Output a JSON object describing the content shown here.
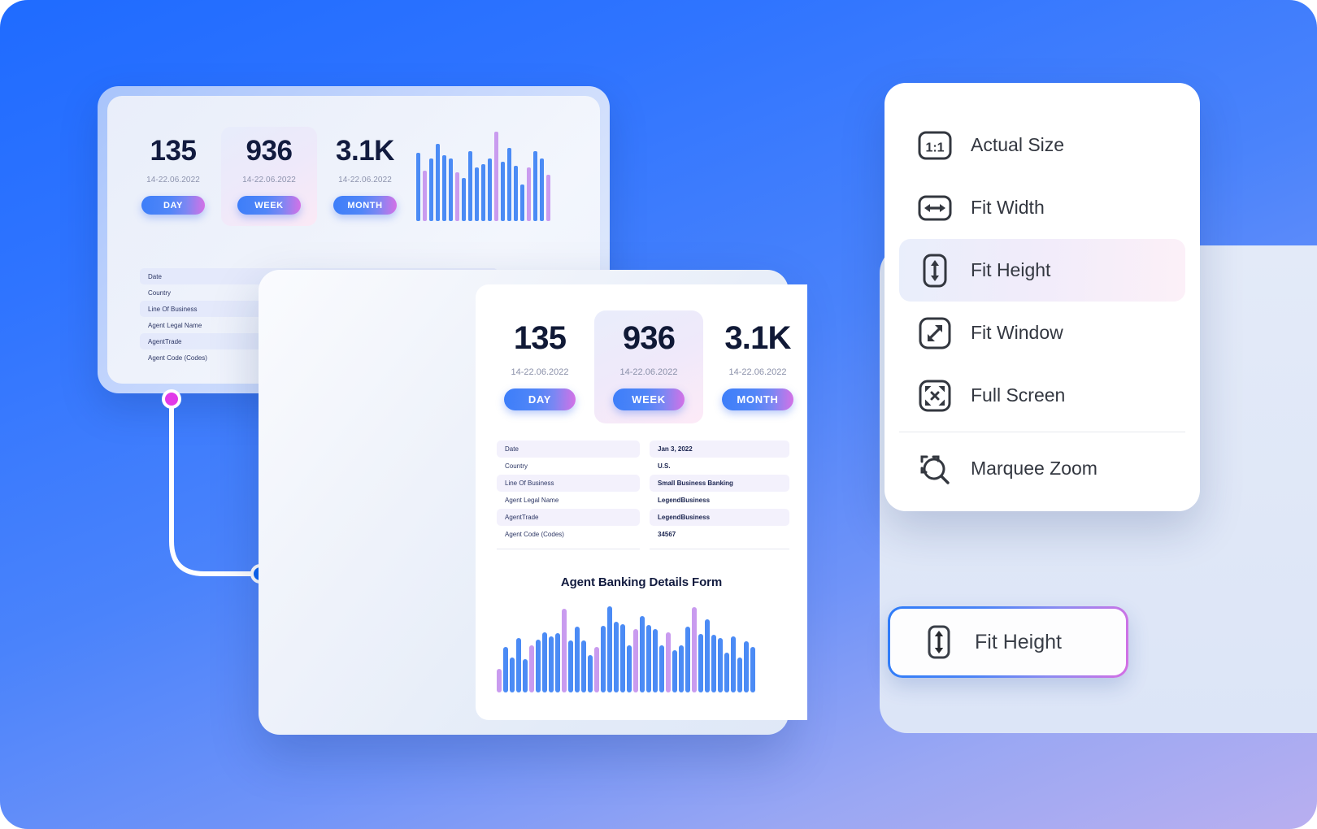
{
  "theme": {
    "bg_start": "#1f6bff",
    "bg_end": "#b9aff0",
    "accent_blue": "#0b64f4",
    "accent_magenta": "#e13ae8",
    "bar_blue": "#4b8bf5",
    "bar_purple": "#c99bef",
    "kpi_text": "#101936"
  },
  "back_dashboard": {
    "kpis": [
      {
        "value": "135",
        "date": "14-22.06.2022",
        "button": "DAY",
        "active": false
      },
      {
        "value": "936",
        "date": "14-22.06.2022",
        "button": "WEEK",
        "active": true
      },
      {
        "value": "3.1K",
        "date": "14-22.06.2022",
        "button": "MONTH",
        "active": false
      }
    ],
    "table_rows": [
      {
        "label": "Date"
      },
      {
        "label": "Country"
      },
      {
        "label": "Line Of Business"
      },
      {
        "label": "Agent Legal Name"
      },
      {
        "label": "AgentTrade"
      },
      {
        "label": "Agent Code (Codes)"
      }
    ]
  },
  "front_dashboard": {
    "kpis": [
      {
        "value": "135",
        "date": "14-22.06.2022",
        "button": "DAY",
        "active": false
      },
      {
        "value": "936",
        "date": "14-22.06.2022",
        "button": "WEEK",
        "active": true
      },
      {
        "value": "3.1K",
        "date": "14-22.06.2022",
        "button": "MONTH",
        "active": false
      }
    ],
    "table_rows": [
      {
        "label": "Date",
        "value": "Jan 3, 2022"
      },
      {
        "label": "Country",
        "value": "U.S."
      },
      {
        "label": "Line Of Business",
        "value": "Small Business Banking"
      },
      {
        "label": "Agent Legal Name",
        "value": "LegendBusiness"
      },
      {
        "label": "AgentTrade",
        "value": "LegendBusiness"
      },
      {
        "label": "Agent Code (Codes)",
        "value": "34567"
      }
    ],
    "chart_title": "Agent Banking Details Form"
  },
  "zoom_menu": {
    "items": [
      {
        "label": "Actual Size",
        "icon": "actual-size-icon",
        "selected": false,
        "separator_before": false
      },
      {
        "label": "Fit Width",
        "icon": "fit-width-icon",
        "selected": false,
        "separator_before": false
      },
      {
        "label": "Fit Height",
        "icon": "fit-height-icon",
        "selected": true,
        "separator_before": false
      },
      {
        "label": "Fit Window",
        "icon": "fit-window-icon",
        "selected": false,
        "separator_before": false
      },
      {
        "label": "Full Screen",
        "icon": "full-screen-icon",
        "selected": false,
        "separator_before": false
      },
      {
        "label": "Marquee Zoom",
        "icon": "marquee-zoom-icon",
        "selected": false,
        "separator_before": true
      }
    ]
  },
  "fit_height_button": {
    "label": "Fit Height",
    "icon": "fit-height-icon"
  },
  "chart_data": [
    {
      "id": "front-chart",
      "type": "bar",
      "title": "Agent Banking Details Form",
      "xlabel": "",
      "ylabel": "",
      "ylim": [
        0,
        100
      ],
      "grid": false,
      "legend": "none",
      "categories": [
        "1",
        "2",
        "3",
        "4",
        "5",
        "6",
        "7",
        "8",
        "9",
        "10",
        "11",
        "12",
        "13",
        "14",
        "15",
        "16",
        "17",
        "18",
        "19",
        "20",
        "21",
        "22",
        "23",
        "24",
        "25",
        "26",
        "27",
        "28",
        "29",
        "30",
        "31",
        "32",
        "33",
        "34",
        "35",
        "36",
        "37",
        "38",
        "39",
        "40"
      ],
      "values": [
        26,
        50,
        38,
        60,
        37,
        52,
        58,
        66,
        62,
        65,
        92,
        57,
        72,
        57,
        41,
        50,
        73,
        95,
        78,
        75,
        52,
        70,
        84,
        74,
        70,
        52,
        66,
        46,
        52,
        72,
        94,
        64,
        80,
        63,
        60,
        44,
        62,
        38,
        56,
        50
      ],
      "bar_colors": [
        "purple",
        "blue",
        "blue",
        "blue",
        "blue",
        "purple",
        "blue",
        "blue",
        "blue",
        "blue",
        "purple",
        "blue",
        "blue",
        "blue",
        "blue",
        "purple",
        "blue",
        "blue",
        "blue",
        "blue",
        "blue",
        "purple",
        "blue",
        "blue",
        "blue",
        "blue",
        "purple",
        "blue",
        "blue",
        "blue",
        "purple",
        "blue",
        "blue",
        "blue",
        "blue",
        "blue",
        "blue",
        "blue",
        "blue",
        "blue"
      ]
    },
    {
      "id": "back-chart",
      "type": "bar",
      "title": "",
      "xlabel": "",
      "ylabel": "",
      "ylim": [
        0,
        100
      ],
      "grid": false,
      "legend": "none",
      "categories": [
        "1",
        "2",
        "3",
        "4",
        "5",
        "6",
        "7",
        "8",
        "9",
        "10",
        "11",
        "12",
        "13",
        "14",
        "15",
        "16",
        "17",
        "18",
        "19",
        "20",
        "21"
      ],
      "values": [
        76,
        56,
        70,
        86,
        74,
        70,
        55,
        48,
        78,
        60,
        64,
        70,
        100,
        66,
        82,
        62,
        41,
        60,
        78,
        70,
        52
      ],
      "bar_colors": [
        "blue",
        "purple",
        "blue",
        "blue",
        "blue",
        "blue",
        "purple",
        "blue",
        "blue",
        "blue",
        "blue",
        "blue",
        "purple",
        "blue",
        "blue",
        "blue",
        "blue",
        "purple",
        "blue",
        "blue",
        "purple"
      ]
    }
  ]
}
